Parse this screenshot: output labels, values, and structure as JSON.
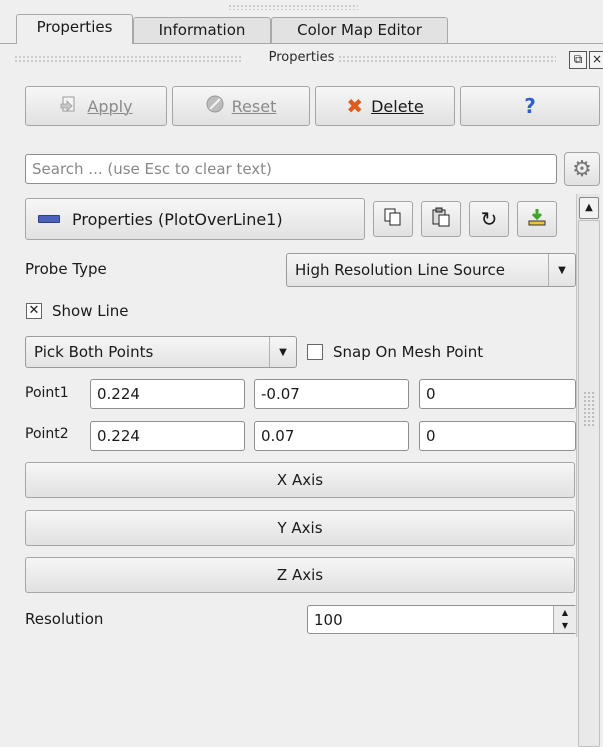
{
  "tabs": [
    "Properties",
    "Information",
    "Color Map Editor"
  ],
  "dock": {
    "title": "Properties"
  },
  "actions": {
    "apply": "Apply",
    "reset": "Reset",
    "delete": "Delete",
    "help": "?"
  },
  "search": {
    "placeholder": "Search ... (use Esc to clear text)"
  },
  "section": {
    "label": "Properties (PlotOverLine1)"
  },
  "probe": {
    "label": "Probe Type",
    "value": "High Resolution Line Source"
  },
  "show_line": {
    "label": "Show Line",
    "checked": true
  },
  "pick": {
    "value": "Pick Both Points"
  },
  "snap": {
    "label": "Snap On Mesh Point",
    "checked": false
  },
  "point1": {
    "label": "Point1",
    "x": "0.224",
    "y": "-0.07",
    "z": "0"
  },
  "point2": {
    "label": "Point2",
    "x": "0.224",
    "y": "0.07",
    "z": "0"
  },
  "axis_buttons": [
    "X Axis",
    "Y Axis",
    "Z Axis"
  ],
  "resolution": {
    "label": "Resolution",
    "value": "100"
  },
  "colors": {
    "delete_icon": "#e05a1a",
    "help_icon": "#2f5fd0",
    "apply_icon": "#9a9a9a",
    "section_icon": "#2c3f8f",
    "download_icon": "#3fa32f"
  }
}
